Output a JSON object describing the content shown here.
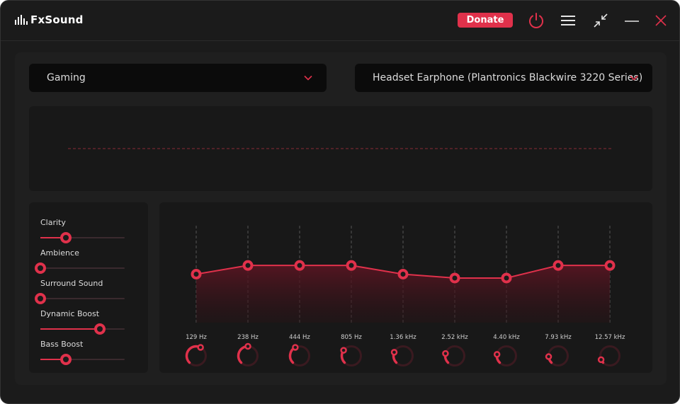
{
  "app": {
    "title": "FxSound"
  },
  "titlebar": {
    "donate_label": "Donate"
  },
  "colors": {
    "accent": "#e0314b",
    "background": "#1b1b1b",
    "panel": "#1f1f1f"
  },
  "icons": [
    "app-logo-bars-icon",
    "power-icon",
    "menu-icon",
    "minimize-view-icon",
    "window-minimize-icon",
    "close-icon",
    "chevron-down-icon"
  ],
  "preset": {
    "selected": "Gaming"
  },
  "output": {
    "selected": "Headset Earphone (Plantronics Blackwire 3220 Series)"
  },
  "effects": [
    {
      "label": "Clarity",
      "value": 0.3
    },
    {
      "label": "Ambience",
      "value": 0.0
    },
    {
      "label": "Surround Sound",
      "value": 0.0
    },
    {
      "label": "Dynamic Boost",
      "value": 0.71
    },
    {
      "label": "Bass Boost",
      "value": 0.3
    }
  ],
  "eq": {
    "bands": [
      {
        "label": "129 Hz",
        "level": 0.5
      },
      {
        "label": "238 Hz",
        "level": 0.59
      },
      {
        "label": "444 Hz",
        "level": 0.59
      },
      {
        "label": "805 Hz",
        "level": 0.59
      },
      {
        "label": "1.36 kHz",
        "level": 0.5
      },
      {
        "label": "2.52 kHz",
        "level": 0.46
      },
      {
        "label": "4.40 kHz",
        "level": 0.46
      },
      {
        "label": "7.93 kHz",
        "level": 0.59
      },
      {
        "label": "12.57 kHz",
        "level": 0.59
      }
    ],
    "knob_levels": [
      0.6,
      0.5,
      0.4,
      0.3,
      0.25,
      0.22,
      0.2,
      0.15,
      0.08
    ]
  }
}
